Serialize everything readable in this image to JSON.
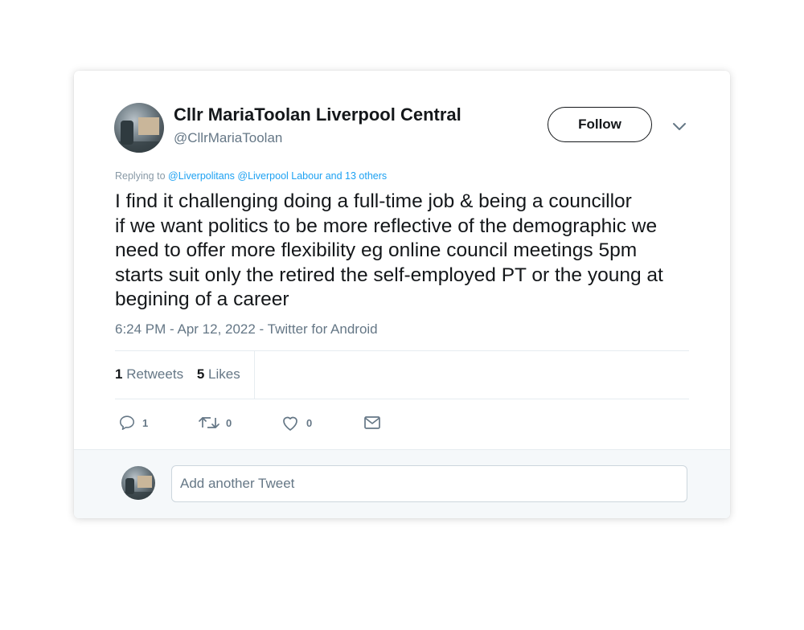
{
  "user": {
    "display_name": "Cllr MariaToolan Liverpool Central",
    "handle": "@CllrMariaToolan"
  },
  "follow_label": "Follow",
  "replying": {
    "prefix": "Replying to",
    "mentions": [
      "@Liverpolitans",
      "@Liverpool Labour"
    ],
    "others": "and 13 others"
  },
  "tweet_lines": [
    "I find it challenging doing a full-time job & being a councillor",
    "if we want politics to be more reflective of the demographic we",
    "need to offer more flexibility eg online council meetings 5pm",
    "starts suit only the retired the  self-employed PT or the young at",
    "begining of a career"
  ],
  "meta": "6:24 PM - Apr 12, 2022 - Twitter for Android",
  "stats": {
    "retweets_count": "1",
    "retweets_label": "Retweets",
    "likes_count": "5",
    "likes_label": "Likes"
  },
  "actions": {
    "reply_count": "1",
    "retweet_count": "0",
    "like_count": "0"
  },
  "icons": [
    "chevron-down-icon",
    "reply-icon",
    "retweet-icon",
    "heart-icon",
    "mail-icon"
  ],
  "colors": {
    "link": "#1da1f2",
    "muted": "#657786",
    "text": "#14171a"
  },
  "reply_box": {
    "placeholder": "Add another Tweet"
  }
}
